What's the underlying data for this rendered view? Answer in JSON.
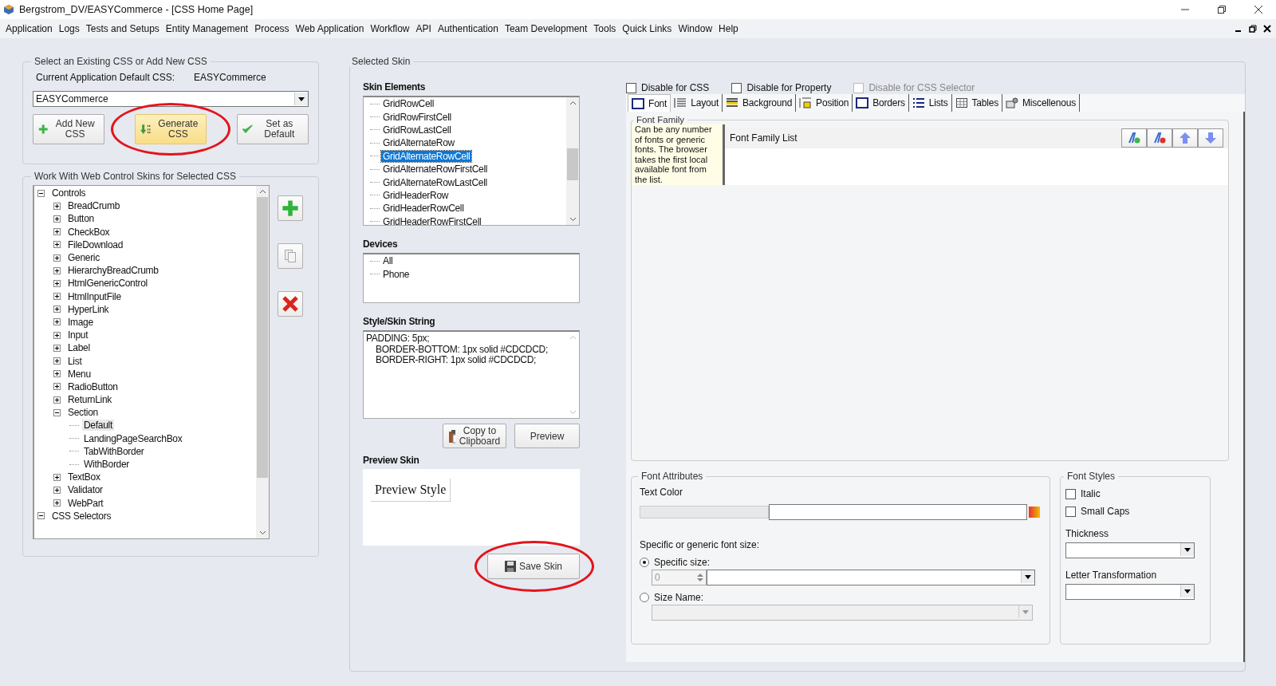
{
  "window": {
    "title": "Bergstrom_DV/EASYCommerce - [CSS Home Page]"
  },
  "menu": [
    "Application",
    "Logs",
    "Tests and Setups",
    "Entity Management",
    "Process",
    "Web Application",
    "Workflow",
    "API",
    "Authentication",
    "Team Development",
    "Tools",
    "Quick Links",
    "Window",
    "Help"
  ],
  "css_select": {
    "legend": "Select an Existing CSS or Add New CSS",
    "default_label": "Current Application Default CSS:",
    "default_value": "EASYCommerce",
    "dropdown": "EASYCommerce",
    "buttons": [
      {
        "label": "Add New CSS",
        "kind": "add",
        "highlighted": false,
        "circled": false
      },
      {
        "label": "Generate CSS",
        "kind": "generate",
        "highlighted": true,
        "circled": true
      },
      {
        "label": "Set as Default",
        "kind": "default",
        "highlighted": false,
        "circled": false
      }
    ]
  },
  "skins_panel": {
    "legend": "Work With Web Control Skins for Selected CSS",
    "tree": [
      {
        "label": "Controls",
        "expanded": true,
        "selected": false,
        "children": [
          {
            "label": "BreadCrumb",
            "expanded": false,
            "selected": false
          },
          {
            "label": "Button",
            "expanded": false,
            "selected": false
          },
          {
            "label": "CheckBox",
            "expanded": false,
            "selected": false
          },
          {
            "label": "FileDownload",
            "expanded": false,
            "selected": false
          },
          {
            "label": "Generic",
            "expanded": false,
            "selected": false
          },
          {
            "label": "HierarchyBreadCrumb",
            "expanded": false,
            "selected": false
          },
          {
            "label": "HtmlGenericControl",
            "expanded": false,
            "selected": false
          },
          {
            "label": "HtmlInputFile",
            "expanded": false,
            "selected": false
          },
          {
            "label": "HyperLink",
            "expanded": false,
            "selected": false
          },
          {
            "label": "Image",
            "expanded": false,
            "selected": false
          },
          {
            "label": "Input",
            "expanded": false,
            "selected": false
          },
          {
            "label": "Label",
            "expanded": false,
            "selected": false
          },
          {
            "label": "List",
            "expanded": false,
            "selected": false
          },
          {
            "label": "Menu",
            "expanded": false,
            "selected": false
          },
          {
            "label": "RadioButton",
            "expanded": false,
            "selected": false
          },
          {
            "label": "ReturnLink",
            "expanded": false,
            "selected": false
          },
          {
            "label": "Section",
            "expanded": true,
            "selected": false,
            "children": [
              {
                "label": "Default",
                "selected": true
              },
              {
                "label": "LandingPageSearchBox",
                "selected": false
              },
              {
                "label": "TabWithBorder",
                "selected": false
              },
              {
                "label": "WithBorder",
                "selected": false
              }
            ]
          },
          {
            "label": "TextBox",
            "expanded": false,
            "selected": false
          },
          {
            "label": "Validator",
            "expanded": false,
            "selected": false
          },
          {
            "label": "WebPart",
            "expanded": false,
            "selected": false
          }
        ]
      },
      {
        "label": "CSS Selectors",
        "expanded": true,
        "selected": false
      }
    ]
  },
  "selected_skin": {
    "legend": "Selected Skin",
    "skin_elements": {
      "title": "Skin Elements",
      "items": [
        {
          "label": "GridRowCell",
          "selected": false
        },
        {
          "label": "GridRowFirstCell",
          "selected": false
        },
        {
          "label": "GridRowLastCell",
          "selected": false
        },
        {
          "label": "GridAlternateRow",
          "selected": false
        },
        {
          "label": "GridAlternateRowCell",
          "selected": true
        },
        {
          "label": "GridAlternateRowFirstCell",
          "selected": false
        },
        {
          "label": "GridAlternateRowLastCell",
          "selected": false
        },
        {
          "label": "GridHeaderRow",
          "selected": false
        },
        {
          "label": "GridHeaderRowCell",
          "selected": false
        },
        {
          "label": "GridHeaderRowFirstCell",
          "selected": false
        }
      ]
    },
    "devices": {
      "title": "Devices",
      "items": [
        "All",
        "Phone"
      ]
    },
    "style_string": {
      "title": "Style/Skin String",
      "lines": [
        "PADDING: 5px;",
        "BORDER-BOTTOM: 1px solid #CDCDCD;",
        "BORDER-RIGHT: 1px solid #CDCDCD;"
      ]
    },
    "copy_button": "Copy to Clipboard",
    "preview_button": "Preview",
    "preview": {
      "title": "Preview Skin",
      "sample": "Preview Style"
    },
    "save_button": {
      "label": "Save Skin",
      "circled": true
    }
  },
  "options": [
    {
      "label": "Disable for CSS",
      "checked": false,
      "disabled": false
    },
    {
      "label": "Disable for Property",
      "checked": false,
      "disabled": false
    },
    {
      "label": "Disable for CSS Selector",
      "checked": false,
      "disabled": true
    }
  ],
  "tabs": [
    {
      "label": "Font",
      "selected": true
    },
    {
      "label": "Layout",
      "selected": false
    },
    {
      "label": "Background",
      "selected": false
    },
    {
      "label": "Position",
      "selected": false
    },
    {
      "label": "Borders",
      "selected": false
    },
    {
      "label": "Lists",
      "selected": false
    },
    {
      "label": "Tables",
      "selected": false
    },
    {
      "label": "Miscellenous",
      "selected": false
    }
  ],
  "font_family": {
    "legend": "Font Family",
    "note": "Can be any number of fonts or generic fonts. The browser takes the first local available font from the list.",
    "list_title": "Font Family List"
  },
  "font_attributes": {
    "legend": "Font Attributes",
    "text_color_label": "Text Color",
    "size_label": "Specific or generic font size:",
    "size_options": [
      {
        "label": "Specific size:",
        "selected": true
      },
      {
        "label": "Size Name:",
        "selected": false
      }
    ],
    "spin_value": "0"
  },
  "font_styles": {
    "legend": "Font Styles",
    "checks": [
      {
        "label": "Italic",
        "checked": false
      },
      {
        "label": "Small Caps",
        "checked": false
      }
    ],
    "thickness_label": "Thickness",
    "letter_label": "Letter Transformation"
  }
}
